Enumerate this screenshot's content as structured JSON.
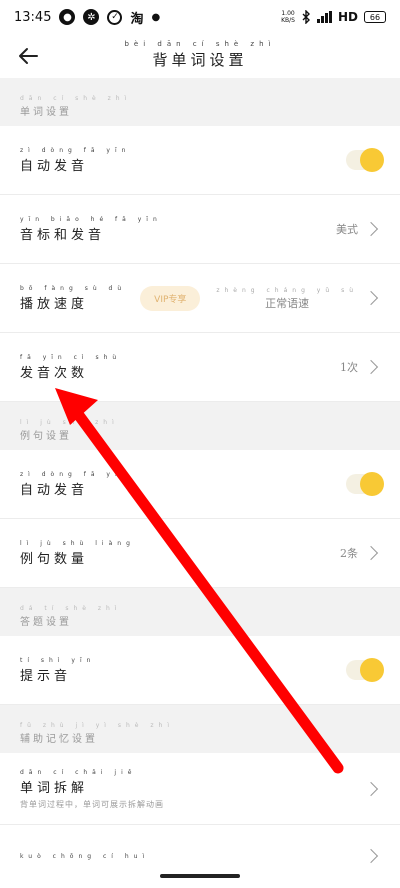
{
  "status_bar": {
    "time": "13:45",
    "taobao": "淘",
    "net_speed_value": "1.00",
    "net_speed_unit": "KB/S",
    "network": "HD",
    "battery": "66"
  },
  "header": {
    "title": "背单词设置",
    "title_pinyin": "bèi dān cí shè zhì"
  },
  "sections": [
    {
      "label": "单词设置",
      "label_pinyin": "dān cí shè zhì",
      "rows": [
        {
          "label": "自动发音",
          "pinyin": "zì dòng fā yīn",
          "type": "toggle",
          "enabled": true
        },
        {
          "label": "音标和发音",
          "pinyin": "yīn biāo hé fā yīn",
          "type": "select",
          "value": "美式",
          "value_pinyin": ""
        },
        {
          "label": "播放速度",
          "pinyin": "bō fàng sù dù",
          "type": "select",
          "badge": "VIP专享",
          "value": "正常语速",
          "value_pinyin": "zhèng cháng yǔ sù"
        },
        {
          "label": "发音次数",
          "pinyin": "fā yīn cì shù",
          "type": "select",
          "value": "1次",
          "value_pinyin": ""
        }
      ]
    },
    {
      "label": "例句设置",
      "label_pinyin": "lì jù shè zhì",
      "rows": [
        {
          "label": "自动发音",
          "pinyin": "zì dòng fā yīn",
          "type": "toggle",
          "enabled": true
        },
        {
          "label": "例句数量",
          "pinyin": "lì jù shù liàng",
          "type": "select",
          "value": "2条",
          "value_pinyin": ""
        }
      ]
    },
    {
      "label": "答题设置",
      "label_pinyin": "dá tí shè zhì",
      "rows": [
        {
          "label": "提示音",
          "pinyin": "tí shì yīn",
          "type": "toggle",
          "enabled": true
        }
      ]
    },
    {
      "label": "辅助记忆设置",
      "label_pinyin": "fǔ zhù jì yì shè zhì",
      "rows": [
        {
          "label": "单词拆解",
          "pinyin": "dān cí chāi jiě",
          "type": "select",
          "sub": "背单词过程中，单词可展示拆解动画"
        }
      ]
    }
  ],
  "partial_row_pinyin": "kuò chōng cí huì",
  "colors": {
    "toggle_knob": "#f8c935",
    "toggle_track": "#f4f0e2",
    "vip_bg": "#fbefd9",
    "vip_text": "#e0b371",
    "section_bg": "#f2f2f2",
    "annotation_arrow": "#ff0000"
  },
  "icons": {
    "back": "arrow-left-icon",
    "chevron": "chevron-right-icon"
  }
}
